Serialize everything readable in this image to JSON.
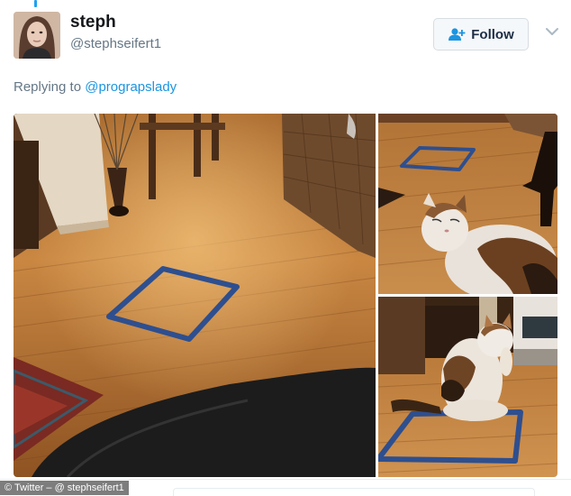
{
  "tweet": {
    "user": {
      "display_name": "steph",
      "handle": "@stephseifert1"
    },
    "follow_label": "Follow",
    "reply_prefix": "Replying to",
    "reply_to": "@prograpslady"
  },
  "media": {
    "photos": [
      {
        "icon": "photo-tape-square-floor"
      },
      {
        "icon": "photo-cat-near-tape-square"
      },
      {
        "icon": "photo-cat-sitting-in-tape-square"
      }
    ]
  },
  "credit": "© Twitter – @ stephseifert1",
  "colors": {
    "accent": "#1da1f2",
    "link": "#1b95e0",
    "secondary_text": "#657786",
    "tape_blue": "#2e4f8f"
  }
}
